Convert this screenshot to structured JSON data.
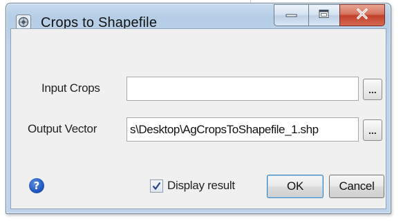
{
  "window": {
    "title": "Crops to Shapefile",
    "app_icon": "qgis-icon",
    "controls": {
      "minimize_icon": "minimize-icon",
      "maximize_icon": "maximize-icon",
      "close_label": "X"
    }
  },
  "form": {
    "input_crops": {
      "label": "Input Crops",
      "value": "",
      "browse_label": "..."
    },
    "output_vector": {
      "label": "Output Vector",
      "value": "s\\Desktop\\AgCropsToShapefile_1.shp",
      "browse_label": "..."
    }
  },
  "footer": {
    "help_icon_glyph": "?",
    "display_result": {
      "label": "Display result",
      "checked": true
    },
    "ok_label": "OK",
    "cancel_label": "Cancel"
  }
}
